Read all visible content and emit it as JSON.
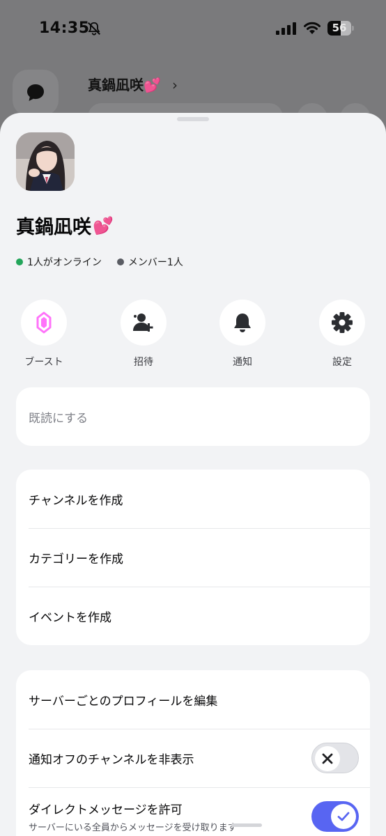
{
  "status_bar": {
    "time": "14:35",
    "battery": "56",
    "battery_level": 0.56
  },
  "background": {
    "server_name": "真鍋凪咲💕",
    "chevron": "›"
  },
  "server": {
    "name": "真鍋凪咲",
    "emoji": "💕",
    "online_text": "1人がオンライン",
    "members_text": "メンバー1人",
    "online_color": "#23a55a",
    "member_dot_color": "#5a5c63"
  },
  "actions": [
    {
      "label": "ブースト",
      "icon": "boost-gem-icon",
      "color": "#ff73fa"
    },
    {
      "label": "招待",
      "icon": "add-person-icon",
      "color": "#2b2d31"
    },
    {
      "label": "通知",
      "icon": "bell-icon",
      "color": "#2b2d31"
    },
    {
      "label": "設定",
      "icon": "gear-icon",
      "color": "#2b2d31"
    }
  ],
  "mark_read": {
    "label": "既読にする"
  },
  "create_menu": {
    "channel": "チャンネルを作成",
    "category": "カテゴリーを作成",
    "event": "イベントを作成"
  },
  "settings_menu": {
    "edit_profile": "サーバーごとのプロフィールを編集",
    "hide_muted": "通知オフのチャンネルを非表示",
    "hide_muted_enabled": false,
    "allow_dm": "ダイレクトメッセージを許可",
    "allow_dm_sub": "サーバーにいる全員からメッセージを受け取ります",
    "allow_dm_enabled": true
  },
  "colors": {
    "accent": "#5865f2",
    "boost": "#ff73fa"
  }
}
